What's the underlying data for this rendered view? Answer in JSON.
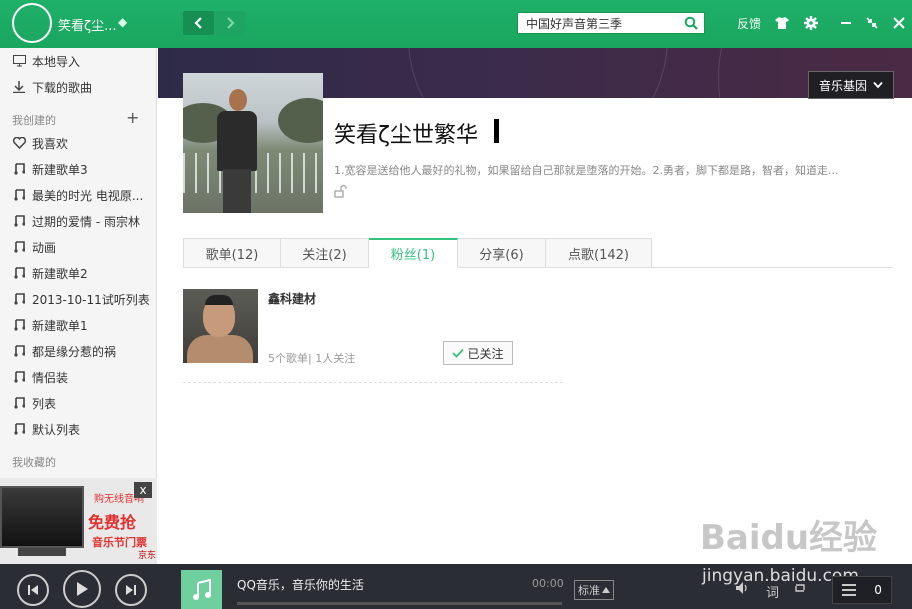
{
  "header": {
    "username": "笑看ζ尘...",
    "search_value": "中国好声音第三季",
    "feedback": "反馈"
  },
  "sidebar": {
    "top_items": [
      {
        "label": "本地导入",
        "icon": "monitor-icon"
      },
      {
        "label": "下载的歌曲",
        "icon": "download-icon"
      }
    ],
    "created_section": "我创建的",
    "items": [
      {
        "label": "我喜欢",
        "icon": "heart-icon"
      },
      {
        "label": "新建歌单3",
        "icon": "music-note-icon"
      },
      {
        "label": "最美的时光 电视原...",
        "icon": "music-note-icon"
      },
      {
        "label": "过期的爱情 - 雨宗林",
        "icon": "music-note-icon"
      },
      {
        "label": "动画",
        "icon": "music-note-icon"
      },
      {
        "label": "新建歌单2",
        "icon": "music-note-icon"
      },
      {
        "label": "2013-10-11试听列表",
        "icon": "music-note-icon"
      },
      {
        "label": "新建歌单1",
        "icon": "music-note-icon"
      },
      {
        "label": "都是缘分惹的祸",
        "icon": "music-note-icon"
      },
      {
        "label": "情侣装",
        "icon": "music-note-icon"
      },
      {
        "label": "列表",
        "icon": "music-note-icon"
      },
      {
        "label": "默认列表",
        "icon": "music-note-icon"
      }
    ],
    "collected_section": "我收藏的",
    "ad": {
      "top": "购无线音响",
      "headline": "免费抢",
      "sub": "音乐节门票",
      "brand": "京东",
      "close": "x"
    }
  },
  "profile": {
    "gene_button": "音乐基因",
    "name": "笑看ζ尘世繁华",
    "description": "1.宽容是送给他人最好的礼物，如果留给自己那就是堕落的开始。2.勇者，脚下都是路，智者，知道走..."
  },
  "tabs": [
    {
      "label": "歌单(12)",
      "active": false
    },
    {
      "label": "关注(2)",
      "active": false
    },
    {
      "label": "粉丝(1)",
      "active": true
    },
    {
      "label": "分享(6)",
      "active": false
    },
    {
      "label": "点歌(142)",
      "active": false
    }
  ],
  "fan": {
    "name": "鑫科建材",
    "stats": "5个歌单| 1人关注",
    "follow_label": "已关注"
  },
  "player": {
    "song": "QQ音乐，音乐你的生活",
    "time": "00:00",
    "quality": "标准",
    "lyrics": "词",
    "playlist_count": "0"
  },
  "watermark": {
    "logo": "Baidu经验",
    "url": "jingyan.baidu.com"
  },
  "colors": {
    "brand_green": "#31c27c",
    "player_bg": "#2a2d33"
  }
}
